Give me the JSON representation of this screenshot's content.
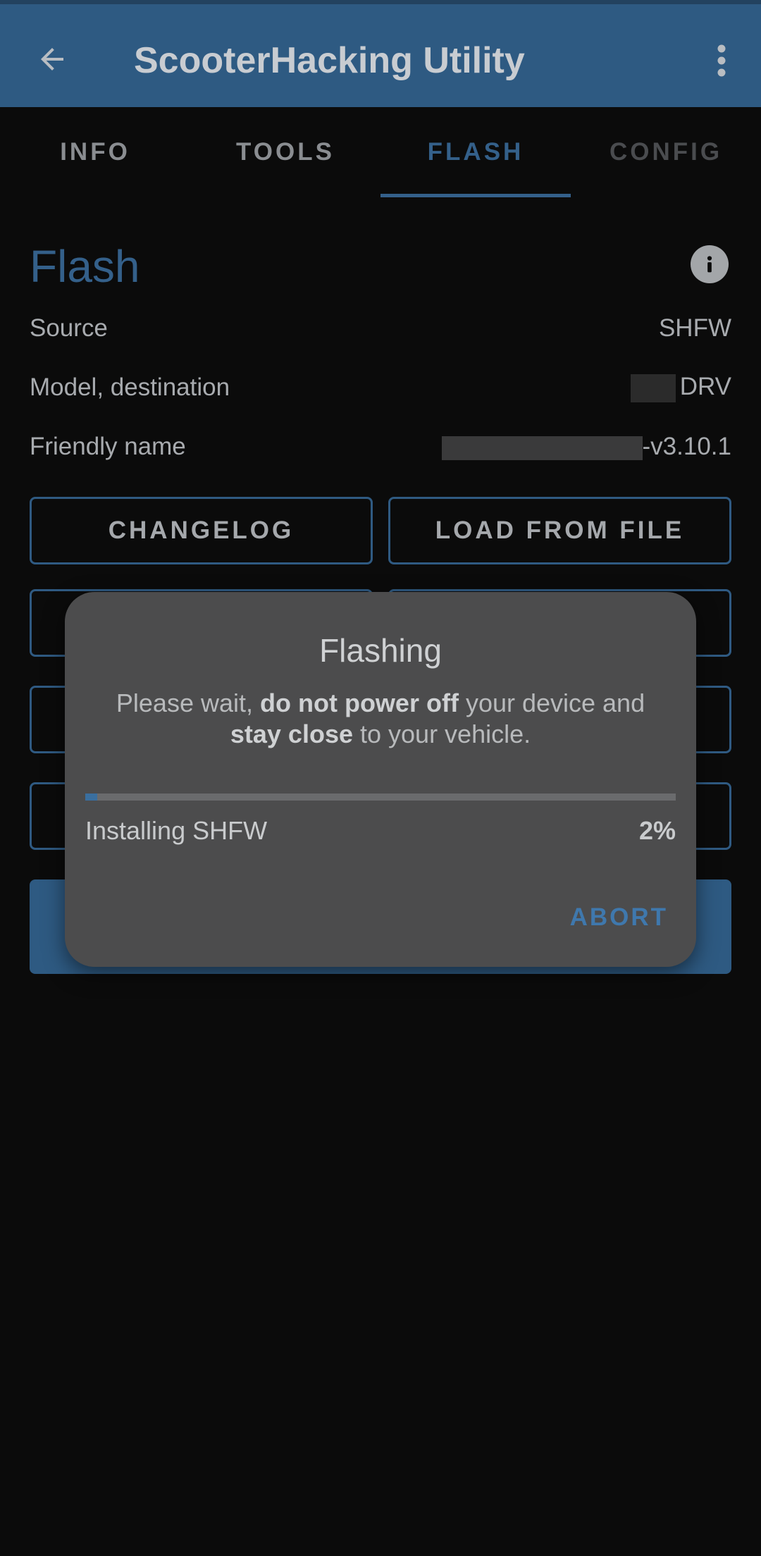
{
  "app_bar": {
    "title": "ScooterHacking Utility",
    "back_icon": "arrow-left-icon",
    "more_icon": "more-vertical-icon"
  },
  "tabs": [
    {
      "label": "INFO"
    },
    {
      "label": "TOOLS"
    },
    {
      "label": "FLASH",
      "active": true
    },
    {
      "label": "CONFIG"
    }
  ],
  "flash": {
    "title": "Flash",
    "info_icon": "info-icon",
    "rows": [
      {
        "label": "Source",
        "value": "SHFW"
      },
      {
        "label": "Model, destination",
        "value": "DRV"
      },
      {
        "label": "Friendly name",
        "value": "-v3.10.1"
      }
    ],
    "buttons": {
      "changelog": "CHANGELOG",
      "load_from_file": "LOAD FROM FILE"
    }
  },
  "dialog": {
    "title": "Flashing",
    "message_part1": "Please wait, ",
    "message_bold1": "do not power off",
    "message_part2": " your device and ",
    "message_bold2": "stay close",
    "message_part3": " to your vehicle.",
    "status": "Installing SHFW",
    "percent_label": "2%",
    "progress": 0.02,
    "abort": "ABORT"
  },
  "colors": {
    "accent": "#34608a",
    "app_bar": "#2e5a82",
    "background": "#0b0b0b",
    "dialog": "#4c4c4d"
  }
}
